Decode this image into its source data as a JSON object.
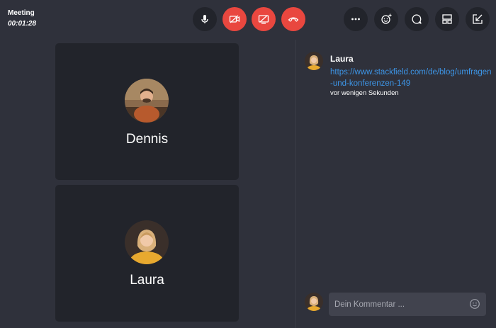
{
  "meeting": {
    "title": "Meeting",
    "timer": "00:01:28"
  },
  "controls": {
    "center": [
      "microphone-icon",
      "camera-off-icon",
      "screen-share-off-icon",
      "hang-up-icon"
    ],
    "right": [
      "more-icon",
      "emoji-add-icon",
      "chat-icon",
      "layout-icon",
      "minimize-icon"
    ],
    "colors": {
      "danger": "#e9473f",
      "dark": "#22242b"
    }
  },
  "participants": [
    {
      "name": "Dennis"
    },
    {
      "name": "Laura"
    }
  ],
  "chat": {
    "messages": [
      {
        "author": "Laura",
        "link": "https://www.stackfield.com/de/blog/umfragen-und-konferenzen-149",
        "time": "vor wenigen Sekunden"
      }
    ],
    "input_placeholder": "Dein Kommentar ..."
  },
  "colors": {
    "background": "#2f313b",
    "tile": "#22242b",
    "link": "#3d95e6"
  }
}
